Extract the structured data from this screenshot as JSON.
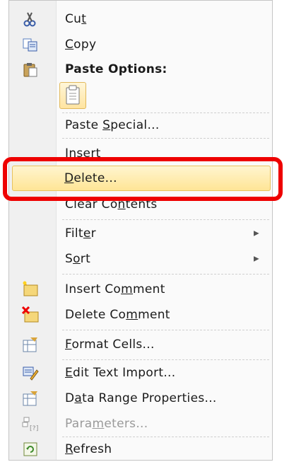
{
  "menu": {
    "items": [
      {
        "id": "cut",
        "before": "Cu",
        "ul": "t",
        "after": "",
        "icon": "scissors-icon"
      },
      {
        "id": "copy",
        "before": "",
        "ul": "C",
        "after": "opy",
        "icon": "copy-icon"
      },
      {
        "id": "paste_options",
        "label": "Paste Options:",
        "icon": "clipboard-icon"
      },
      {
        "id": "paste_special",
        "before": "Paste ",
        "ul": "S",
        "after": "pecial...",
        "icon": ""
      },
      {
        "id": "insert",
        "before": "",
        "ul": "I",
        "after": "nsert",
        "icon": ""
      },
      {
        "id": "delete",
        "before": "",
        "ul": "D",
        "after": "elete...",
        "icon": ""
      },
      {
        "id": "clear_contents",
        "before": "Clear Co",
        "ul": "n",
        "after": "tents",
        "icon": ""
      },
      {
        "id": "filter",
        "before": "Filt",
        "ul": "e",
        "after": "r",
        "icon": "",
        "submenu": true
      },
      {
        "id": "sort",
        "before": "S",
        "ul": "o",
        "after": "rt",
        "icon": "",
        "submenu": true
      },
      {
        "id": "insert_comment",
        "before": "Insert Co",
        "ul": "m",
        "after": "ment",
        "icon": "insert-comment-icon"
      },
      {
        "id": "delete_comment",
        "before": "Delete Co",
        "ul": "m",
        "after": "ment",
        "icon": "delete-comment-icon"
      },
      {
        "id": "format_cells",
        "before": "",
        "ul": "F",
        "after": "ormat Cells...",
        "icon": "format-cells-icon"
      },
      {
        "id": "edit_text_import",
        "before": "",
        "ul": "E",
        "after": "dit Text Import...",
        "icon": "edit-text-import-icon"
      },
      {
        "id": "data_range_properties",
        "before": "D",
        "ul": "a",
        "after": "ta Range Properties...",
        "icon": "data-range-properties-icon"
      },
      {
        "id": "parameters",
        "before": "Para",
        "ul": "m",
        "after": "eters...",
        "icon": "parameters-icon",
        "disabled": true
      },
      {
        "id": "refresh",
        "before": "",
        "ul": "R",
        "after": "efresh",
        "icon": "refresh-icon"
      }
    ],
    "submenu_arrow": "▶",
    "highlighted": "delete"
  },
  "colors": {
    "highlight": "#ffe596",
    "annotation_box": "#ee0000"
  }
}
